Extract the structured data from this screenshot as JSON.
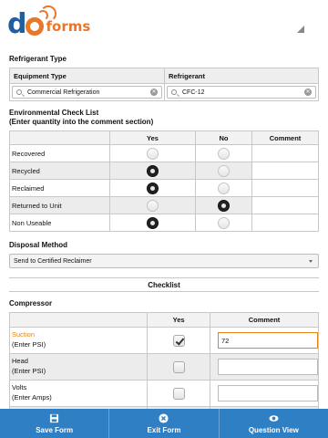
{
  "app": {
    "logo_text_main": "do",
    "logo_text_sub": "forms"
  },
  "refrigerant_type": {
    "title": "Refrigerant Type",
    "col_equipment": "Equipment Type",
    "col_refrigerant": "Refrigerant",
    "equipment_value": "Commercial Refrigeration",
    "refrigerant_value": "CFC-12"
  },
  "env_checklist": {
    "title_line1": "Environmental Check List",
    "title_line2": "(Enter quantity into the comment section)",
    "col_yes": "Yes",
    "col_no": "No",
    "col_comment": "Comment",
    "rows": [
      {
        "label": "Recovered",
        "yes": false,
        "no": false,
        "comment": ""
      },
      {
        "label": "Recycled",
        "yes": true,
        "no": false,
        "comment": ""
      },
      {
        "label": "Reclaimed",
        "yes": true,
        "no": false,
        "comment": ""
      },
      {
        "label": "Returned to Unit",
        "yes": false,
        "no": true,
        "comment": ""
      },
      {
        "label": "Non Useable",
        "yes": true,
        "no": false,
        "comment": ""
      }
    ]
  },
  "disposal": {
    "title": "Disposal Method",
    "value": "Send to Certified Reclaimer"
  },
  "checklist": {
    "title": "Checklist"
  },
  "compressor": {
    "title": "Compressor",
    "col_yes": "Yes",
    "col_comment": "Comment",
    "rows": [
      {
        "label": "Suction",
        "sub": "(Enter PSI)",
        "checked": true,
        "comment": "72",
        "active": true
      },
      {
        "label": "Head",
        "sub": "(Enter PSI)",
        "checked": false,
        "comment": "",
        "active": false
      },
      {
        "label": "Volts",
        "sub": "(Enter Amps)",
        "checked": false,
        "comment": "",
        "active": false
      }
    ]
  },
  "footer": {
    "save": "Save Form",
    "exit": "Exit Form",
    "view": "Question View"
  },
  "colors": {
    "brand_blue": "#2f7fc5",
    "brand_orange": "#e8762b",
    "logo_blue": "#1f5f9e"
  },
  "icons": {
    "save": "floppy-disk-icon",
    "exit": "close-icon",
    "view": "eye-icon",
    "search": "search-icon",
    "clear": "clear-icon",
    "dropdown": "chevron-down-icon"
  }
}
